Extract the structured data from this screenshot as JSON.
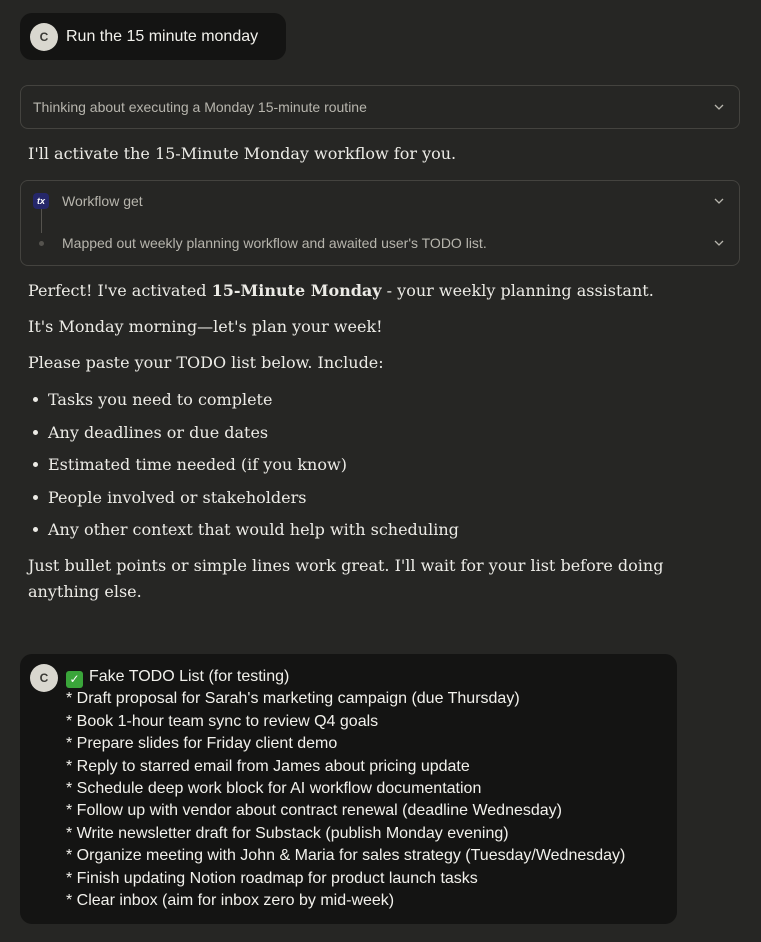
{
  "user_message_1": {
    "avatar": "C",
    "text": "Run the 15 minute monday"
  },
  "thinking": {
    "label": "Thinking about executing a Monday 15-minute routine",
    "icon": "chevron-down-icon"
  },
  "intro": "I'll activate the 15-Minute Monday workflow for you.",
  "workflow": {
    "icon_text": "tx",
    "tool_label": "Workflow get",
    "result_label": "Mapped out weekly planning workflow and awaited user's TODO list."
  },
  "response": {
    "activated_prefix": "Perfect! I've activated ",
    "activated_bold": "15-Minute Monday",
    "activated_suffix": " - your weekly planning assistant.",
    "greeting": "It's Monday morning—let's plan your week!",
    "instruction": "Please paste your TODO list below. Include:",
    "bullets": [
      "Tasks you need to complete",
      "Any deadlines or due dates",
      "Estimated time needed (if you know)",
      "People involved or stakeholders",
      "Any other context that would help with scheduling"
    ],
    "closing": "Just bullet points or simple lines work great. I'll wait for your list before doing anything else."
  },
  "user_message_2": {
    "avatar": "C",
    "title": "Fake TODO List (for testing)",
    "items": [
      "* Draft proposal for Sarah's marketing campaign (due Thursday)",
      "* Book 1-hour team sync to review Q4 goals",
      "* Prepare slides for Friday client demo",
      "* Reply to starred email from James about pricing update",
      "* Schedule deep work block for AI workflow documentation",
      "* Follow up with vendor about contract renewal (deadline Wednesday)",
      "* Write newsletter draft for Substack (publish Monday evening)",
      "* Organize meeting with John & Maria for sales strategy (Tuesday/Wednesday)",
      "* Finish updating Notion roadmap for product launch tasks",
      "* Clear inbox (aim for inbox zero by mid-week)"
    ]
  },
  "colors": {
    "background": "#262624",
    "bubble": "#141413",
    "border": "#44433f",
    "check": "#3aa53a",
    "tx_icon": "#25276a"
  }
}
